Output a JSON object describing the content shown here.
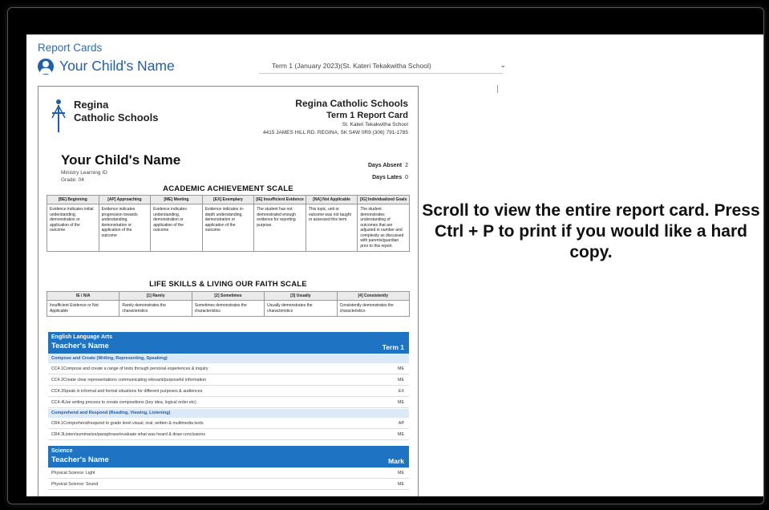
{
  "breadcrumb": "Report Cards",
  "student_name": "Your Child's Name",
  "term_select": {
    "value": "Term 1 (January 2023)(St. Kateri Tekakwitha School)"
  },
  "report_card": {
    "logo_line1": "Regina",
    "logo_line2": "Catholic Schools",
    "division": "Regina Catholic Schools",
    "card_title": "Term 1 Report Card",
    "school": "St. Kateri Tekakwitha School",
    "address": "4415 JAMES HILL RD. REGINA, SK S4W 0R9 (306) 791-1785",
    "child_name": "Your Child's Name",
    "ministry_id": "Ministry Learning ID",
    "grade": "Grade: 04",
    "days_absent_label": "Days Absent",
    "days_absent": "2",
    "days_lates_label": "Days Lates",
    "days_lates": "0",
    "academic_title": "ACADEMIC ACHIEVEMENT SCALE",
    "academic_headers": [
      "[BE] Beginning",
      "[AP] Approaching",
      "[ME] Meeting",
      "[EX] Exemplary",
      "[IE] Insufficient Evidence",
      "[NA] Not Applicable",
      "[IG] Individualized Goals"
    ],
    "academic_desc": [
      "Evidence indicates initial understanding, demonstration or application of the outcome",
      "Evidence indicates progression towards understanding, demonstration or application of the outcome",
      "Evidence indicates understanding, demonstration or application of the outcome",
      "Evidence indicates in-depth understanding, demonstration or application of the outcome",
      "The student has not demonstrated enough evidence for reporting purpose.",
      "This topic, unit or outcome was not taught or assessed this term.",
      "The student demonstrates understanding of outcomes that are adjusted in number and complexity as discussed with parents/guardian prior to this report."
    ],
    "life_title": "LIFE SKILLS & LIVING OUR FAITH SCALE",
    "life_headers": [
      "IE / N/A",
      "[1] Rarely",
      "[2] Sometimes",
      "[3] Usually",
      "[4] Consistently"
    ],
    "life_desc": [
      "Insufficient Evidence or Not Applicable",
      "Rarely demonstrates the characteristics",
      "Sometimes demonstrates the characteristics",
      "Usually demonstrates the characteristics",
      "Consistently demonstrates the characteristics"
    ],
    "ela": {
      "subject": "English Language Arts",
      "teacher": "Teacher's Name",
      "col": "Term 1",
      "group1": "Compose and Create (Writing, Representing, Speaking)",
      "group1_rows": [
        {
          "text": "CC4.1Compose and create a range of texts through personal experiences & inquiry",
          "mark": "ME"
        },
        {
          "text": "CC4.2Create clear representations communicating relevant/purposeful information",
          "mark": "ME"
        },
        {
          "text": "CC4.3Speak in informal and formal situations for different purposes & audiences",
          "mark": "EX"
        },
        {
          "text": "CC4.4Use writing process to create compositions (key idea, logical order etc)",
          "mark": "ME"
        }
      ],
      "group2": "Comprehend and Respond (Reading, Viewing, Listening)",
      "group2_rows": [
        {
          "text": "CR4.1Comprehend/respond to grade level visual, oral, written & multimedia texts",
          "mark": "AP"
        },
        {
          "text": "CR4.3Listen/summarize/paraphrase/evaluate what was heard & draw conclusions",
          "mark": "ME"
        }
      ]
    },
    "science": {
      "subject": "Science",
      "teacher": "Teacher's Name",
      "col": "Mark",
      "rows": [
        {
          "text": "Physical Science: Light",
          "mark": "ME"
        },
        {
          "text": "Physical Science: Sound",
          "mark": "ME"
        }
      ]
    }
  },
  "instruction": "Scroll to view the entire report card. Press Ctrl + P to print if you would like a hard copy."
}
